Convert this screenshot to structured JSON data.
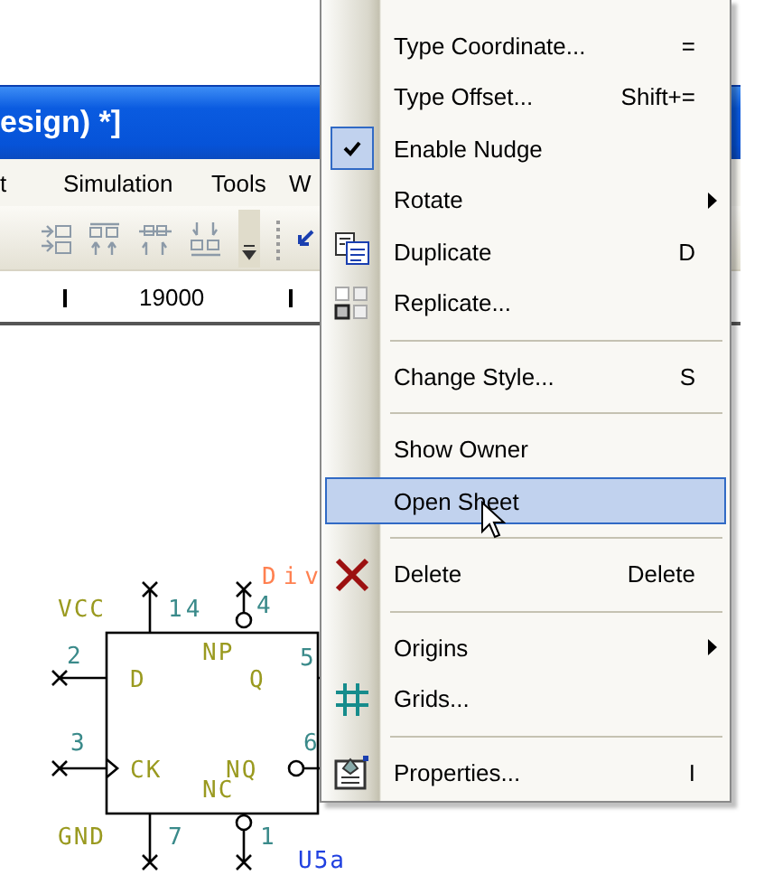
{
  "window": {
    "title": "esign) *]"
  },
  "menu_bar": [
    "t",
    "Simulation",
    "Tools",
    "W"
  ],
  "ruler": {
    "labels": [
      "19000"
    ]
  },
  "schematic": {
    "name_label": "Div",
    "ref_label": "U5a",
    "power_labels": [
      "VCC",
      "GND"
    ],
    "pin_numbers": [
      "14",
      "4",
      "2",
      "5",
      "3",
      "6",
      "7",
      "1"
    ],
    "inner_labels": [
      "NP",
      "D",
      "Q",
      "CK",
      "NQ",
      "NC"
    ]
  },
  "context_menu": {
    "items": [
      {
        "kind": "item",
        "label": "Type Coordinate...",
        "shortcut": "=",
        "checked": false,
        "selected": false,
        "submenu": false
      },
      {
        "kind": "item",
        "label": "Type Offset...",
        "shortcut": "Shift+=",
        "checked": false,
        "selected": false,
        "submenu": false
      },
      {
        "kind": "item",
        "label": "Enable Nudge",
        "checked": true,
        "selected": false,
        "submenu": false
      },
      {
        "kind": "item",
        "label": "Rotate",
        "checked": false,
        "selected": false,
        "submenu": true
      },
      {
        "kind": "item",
        "label": "Duplicate",
        "shortcut": "D",
        "checked": false,
        "selected": false,
        "submenu": false
      },
      {
        "kind": "item",
        "label": "Replicate...",
        "checked": false,
        "selected": false,
        "submenu": false
      },
      {
        "kind": "separator"
      },
      {
        "kind": "item",
        "label": "Change Style...",
        "shortcut": "S",
        "checked": false,
        "selected": false,
        "submenu": false
      },
      {
        "kind": "separator"
      },
      {
        "kind": "item",
        "label": "Show Owner",
        "checked": false,
        "selected": false,
        "submenu": false
      },
      {
        "kind": "item",
        "label": "Open Sheet",
        "checked": false,
        "selected": true,
        "submenu": false
      },
      {
        "kind": "separator"
      },
      {
        "kind": "item",
        "label": "Delete",
        "shortcut": "Delete",
        "checked": false,
        "selected": false,
        "submenu": false
      },
      {
        "kind": "separator"
      },
      {
        "kind": "item",
        "label": "Origins",
        "checked": false,
        "selected": false,
        "submenu": true
      },
      {
        "kind": "item",
        "label": "Grids...",
        "checked": false,
        "selected": false,
        "submenu": false
      },
      {
        "kind": "separator"
      },
      {
        "kind": "item",
        "label": "Properties...",
        "shortcut": "I",
        "checked": false,
        "selected": false,
        "submenu": false
      }
    ]
  }
}
